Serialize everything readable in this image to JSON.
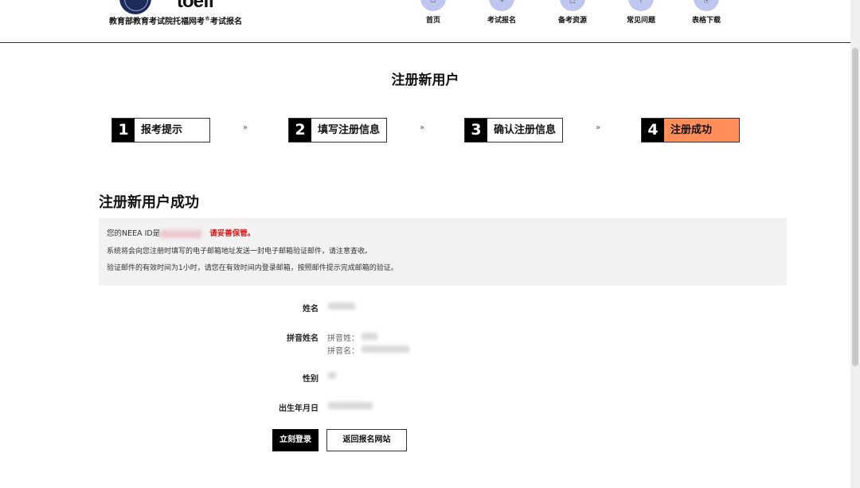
{
  "header": {
    "logo_text": "toefl",
    "site_title": "教育部教育考试院托福网考",
    "site_title_sup": "®",
    "site_title_suffix": "考试报名"
  },
  "nav": [
    {
      "label": "首页",
      "icon": "home-icon"
    },
    {
      "label": "考试报名",
      "icon": "register-icon"
    },
    {
      "label": "备考资源",
      "icon": "resources-icon"
    },
    {
      "label": "常见问题",
      "icon": "faq-icon"
    },
    {
      "label": "表格下载",
      "icon": "download-icon"
    }
  ],
  "page_title": "注册新用户",
  "steps": [
    {
      "num": "1",
      "label": "报考提示",
      "active": false
    },
    {
      "num": "2",
      "label": "填写注册信息",
      "active": false
    },
    {
      "num": "3",
      "label": "确认注册信息",
      "active": false
    },
    {
      "num": "4",
      "label": "注册成功",
      "active": true
    }
  ],
  "step_arrow": "»",
  "success_title": "注册新用户成功",
  "info": {
    "line1_prefix": "您的NEEA ID是",
    "line1_warning": "请妥善保管。",
    "line2": "系统将会向您注册时填写的电子邮箱地址发送一封电子邮箱验证邮件，请注意查收。",
    "line3": "验证邮件的有效时间为1小时，请您在有效时间内登录邮箱，按照邮件提示完成邮箱的验证。"
  },
  "fields": {
    "name_label": "姓名",
    "pinyin_label": "拼音姓名",
    "pinyin_surname_label": "拼音姓：",
    "pinyin_given_label": "拼音名：",
    "gender_label": "性别",
    "birth_label": "出生年月日"
  },
  "buttons": {
    "login": "立刻登录",
    "back": "返回报名网站"
  },
  "colors": {
    "active_step": "#ff8e5a",
    "warning": "#e01818",
    "nav_circle": "#bfc6f0"
  }
}
